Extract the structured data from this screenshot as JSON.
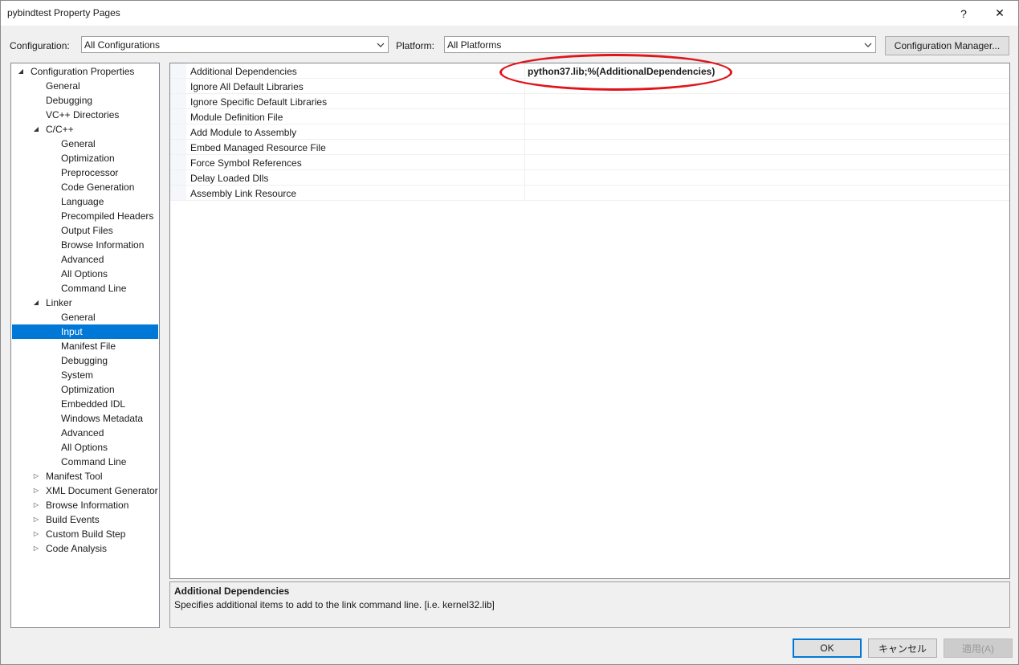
{
  "window": {
    "title": "pybindtest Property Pages",
    "help": "?",
    "close": "✕"
  },
  "config": {
    "configuration_label": "Configuration:",
    "configuration_value": "All Configurations",
    "platform_label": "Platform:",
    "platform_value": "All Platforms",
    "manager_button": "Configuration Manager..."
  },
  "tree": [
    {
      "label": "Configuration Properties",
      "level": 0,
      "twisty": "◢"
    },
    {
      "label": "General",
      "level": 1
    },
    {
      "label": "Debugging",
      "level": 1
    },
    {
      "label": "VC++ Directories",
      "level": 1
    },
    {
      "label": "C/C++",
      "level": 1,
      "twisty": "◢"
    },
    {
      "label": "General",
      "level": 2
    },
    {
      "label": "Optimization",
      "level": 2
    },
    {
      "label": "Preprocessor",
      "level": 2
    },
    {
      "label": "Code Generation",
      "level": 2
    },
    {
      "label": "Language",
      "level": 2
    },
    {
      "label": "Precompiled Headers",
      "level": 2
    },
    {
      "label": "Output Files",
      "level": 2
    },
    {
      "label": "Browse Information",
      "level": 2
    },
    {
      "label": "Advanced",
      "level": 2
    },
    {
      "label": "All Options",
      "level": 2
    },
    {
      "label": "Command Line",
      "level": 2
    },
    {
      "label": "Linker",
      "level": 1,
      "twisty": "◢"
    },
    {
      "label": "General",
      "level": 2
    },
    {
      "label": "Input",
      "level": 2,
      "selected": true
    },
    {
      "label": "Manifest File",
      "level": 2
    },
    {
      "label": "Debugging",
      "level": 2
    },
    {
      "label": "System",
      "level": 2
    },
    {
      "label": "Optimization",
      "level": 2
    },
    {
      "label": "Embedded IDL",
      "level": 2
    },
    {
      "label": "Windows Metadata",
      "level": 2
    },
    {
      "label": "Advanced",
      "level": 2
    },
    {
      "label": "All Options",
      "level": 2
    },
    {
      "label": "Command Line",
      "level": 2
    },
    {
      "label": "Manifest Tool",
      "level": 1,
      "twisty": "▷"
    },
    {
      "label": "XML Document Generator",
      "level": 1,
      "twisty": "▷"
    },
    {
      "label": "Browse Information",
      "level": 1,
      "twisty": "▷"
    },
    {
      "label": "Build Events",
      "level": 1,
      "twisty": "▷"
    },
    {
      "label": "Custom Build Step",
      "level": 1,
      "twisty": "▷"
    },
    {
      "label": "Code Analysis",
      "level": 1,
      "twisty": "▷"
    }
  ],
  "properties": [
    {
      "name": "Additional Dependencies",
      "value": "python37.lib;%(AdditionalDependencies)"
    },
    {
      "name": "Ignore All Default Libraries",
      "value": ""
    },
    {
      "name": "Ignore Specific Default Libraries",
      "value": ""
    },
    {
      "name": "Module Definition File",
      "value": ""
    },
    {
      "name": "Add Module to Assembly",
      "value": ""
    },
    {
      "name": "Embed Managed Resource File",
      "value": ""
    },
    {
      "name": "Force Symbol References",
      "value": ""
    },
    {
      "name": "Delay Loaded Dlls",
      "value": ""
    },
    {
      "name": "Assembly Link Resource",
      "value": ""
    }
  ],
  "description": {
    "title": "Additional Dependencies",
    "text": "Specifies additional items to add to the link command line. [i.e. kernel32.lib]"
  },
  "buttons": {
    "ok": "OK",
    "cancel": "キャンセル",
    "apply": "適用(A)"
  },
  "colors": {
    "selection": "#0078d7",
    "highlight_ellipse": "#e0151c"
  }
}
